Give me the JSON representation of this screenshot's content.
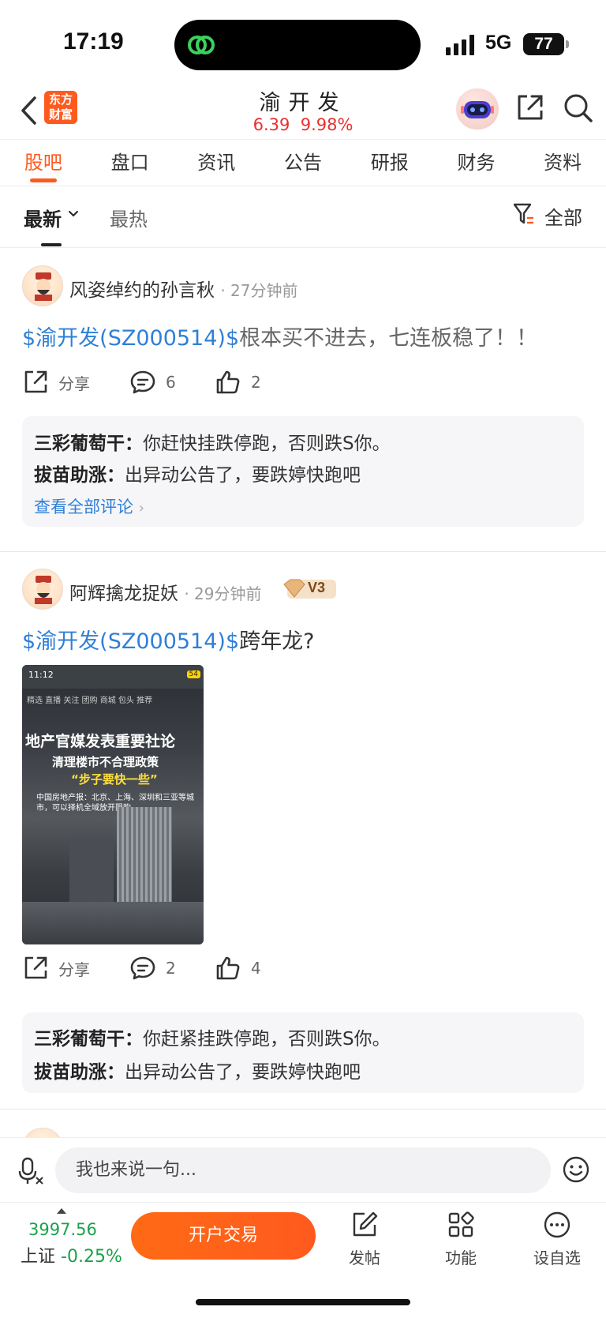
{
  "status": {
    "time": "17:19",
    "network": "5G",
    "battery": "77"
  },
  "header": {
    "logo_line1": "东方",
    "logo_line2": "财富",
    "stock_name": "渝开发",
    "price": "6.39",
    "change_pct": "9.98%"
  },
  "tabs": [
    "股吧",
    "盘口",
    "资讯",
    "公告",
    "研报",
    "财务",
    "资料"
  ],
  "filter": {
    "latest": "最新",
    "hot": "最热",
    "all": "全部"
  },
  "posts": [
    {
      "user": "风姿绰约的孙言秋",
      "time": "27分钟前",
      "stock_tag": "$渝开发(SZ000514)$",
      "text": "根本买不进去，七连板稳了！！",
      "share": "分享",
      "comments": "6",
      "likes": "2",
      "replies": [
        {
          "author": "三彩葡萄干：",
          "text": "你赶快挂跌停跑，否则跌S你。"
        },
        {
          "author": "拔苗助涨：",
          "text": "出异动公告了，要跌婷快跑吧"
        }
      ],
      "see_all": "查看全部评论"
    },
    {
      "user": "阿辉擒龙捉妖",
      "time": "29分钟前",
      "badge": "V3",
      "stock_tag": "$渝开发(SZ000514)$",
      "text": "跨年龙?",
      "image": {
        "time": "11:12",
        "battery": "54",
        "tabs": "精选  直播  关注  团购  商城  包头  推荐",
        "headline": "地产官媒发表重要社论",
        "subline": "清理楼市不合理政策",
        "quote": "“步子要快一些”",
        "caption": "中国房地产报：北京、上海、深圳和三亚等城市，可以择机全域放开限购"
      },
      "share": "分享",
      "comments": "2",
      "likes": "4",
      "replies": [
        {
          "author": "三彩葡萄干：",
          "text": "你赶紧挂跌停跑，否则跌S你。"
        },
        {
          "author": "拔苗助涨：",
          "text": "出异动公告了，要跌婷快跑吧"
        }
      ]
    }
  ],
  "comment_bar": {
    "placeholder": "我也来说一句..."
  },
  "bottom": {
    "index_value": "3997.56",
    "index_name": "上证",
    "index_change": "-0.25%",
    "trade": "开户交易",
    "post": "发帖",
    "func": "功能",
    "watch": "设自选"
  },
  "colors": {
    "accent": "#ff5a1e",
    "up": "#e8312f",
    "down": "#1aa24b",
    "link": "#2f7fd7"
  }
}
